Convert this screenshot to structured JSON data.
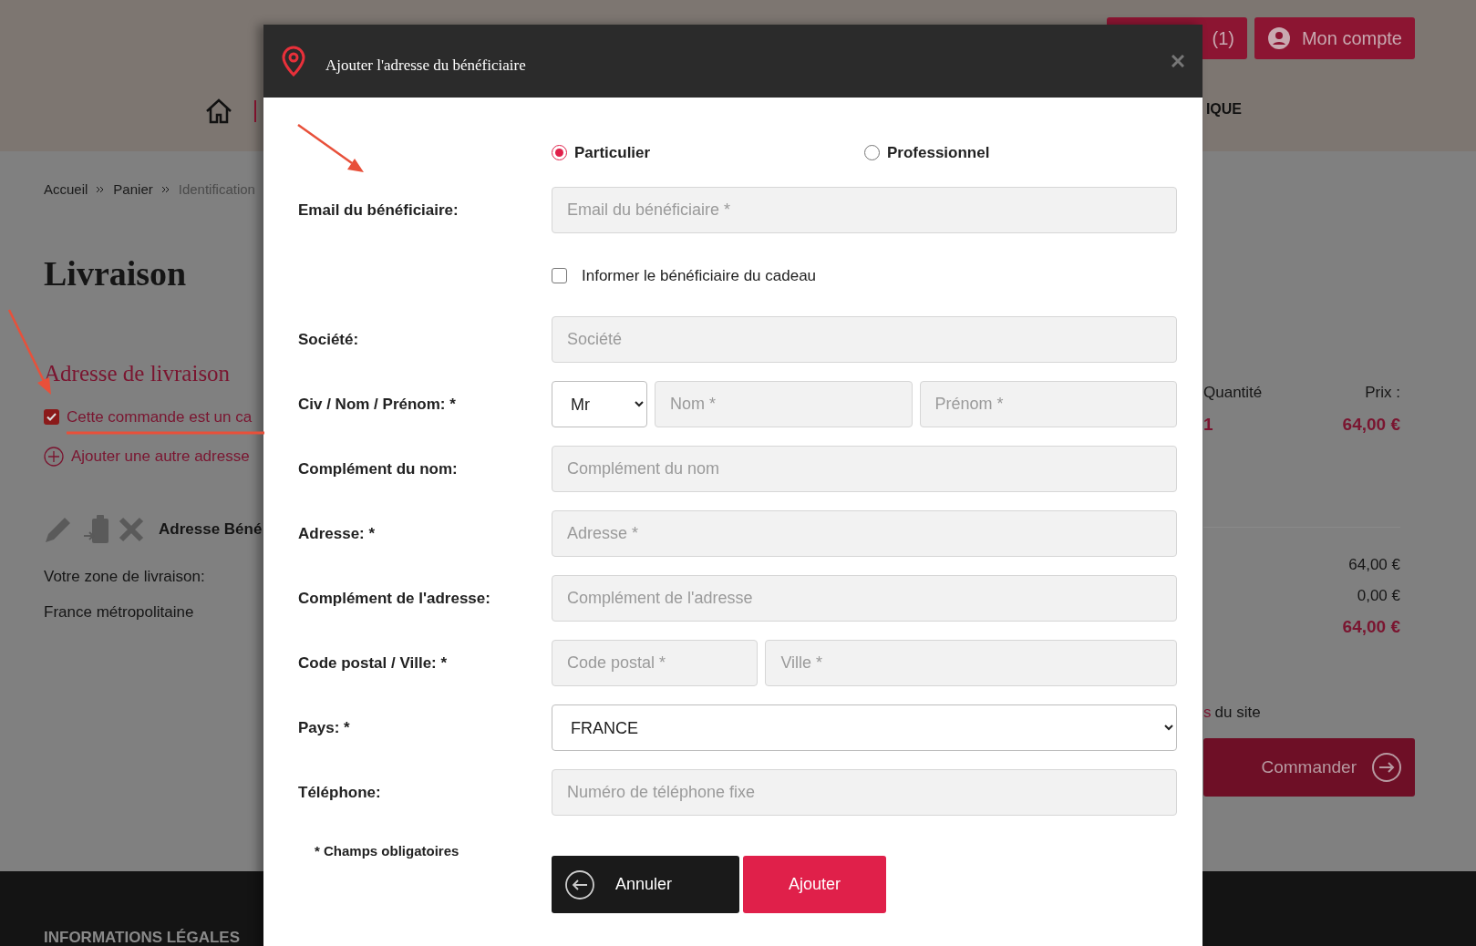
{
  "page": {
    "header": {
      "cart_button": "(1)",
      "account_button": "Mon compte",
      "nav_fragment": "IQUE"
    },
    "breadcrumb": [
      {
        "label": "Accueil",
        "current": false
      },
      {
        "label": "Panier",
        "current": false
      },
      {
        "label": "Identification",
        "current": true
      }
    ],
    "title": "Livraison",
    "section_title": "Adresse de livraison",
    "gift_checkbox": {
      "label": "Cette commande est un ca",
      "checked": true
    },
    "add_address": "Ajouter une autre adresse",
    "address_heading": "Adresse Béné",
    "zone_label": "Votre zone de livraison:",
    "zone_value": "France métropolitaine",
    "summary": {
      "quantity_header": "Quantité",
      "price_header": "Prix :",
      "quantity": "1",
      "price": "64,00 €",
      "subtotal": "64,00 €",
      "shipping": "0,00 €",
      "total": "64,00 €",
      "terms_link_fragment": "s",
      "terms_text": "du site",
      "order_button": "Commander"
    },
    "footer": {
      "heading": "INFORMATIONS LÉGALES"
    }
  },
  "modal": {
    "title": "Ajouter l'adresse du bénéficiaire",
    "customer_types": [
      {
        "label": "Particulier",
        "selected": true
      },
      {
        "label": "Professionnel",
        "selected": false
      }
    ],
    "rows": [
      {
        "label": "Email du bénéficiaire:",
        "controls": [
          {
            "kind": "input",
            "placeholder": "Email du bénéficiaire *"
          }
        ]
      },
      {
        "controls": [
          {
            "kind": "checkbox",
            "label": "Informer le bénéficiaire du cadeau",
            "checked": false
          }
        ]
      },
      {
        "label": "Société:",
        "controls": [
          {
            "kind": "input",
            "placeholder": "Société"
          }
        ]
      },
      {
        "label": "Civ / Nom / Prénom: *",
        "controls": [
          {
            "kind": "select",
            "value": "Mr"
          },
          {
            "kind": "input",
            "placeholder": "Nom *"
          },
          {
            "kind": "input",
            "placeholder": "Prénom *"
          }
        ]
      },
      {
        "label": "Complément du nom:",
        "controls": [
          {
            "kind": "input",
            "placeholder": "Complément du nom"
          }
        ]
      },
      {
        "label": "Adresse: *",
        "controls": [
          {
            "kind": "input",
            "placeholder": "Adresse *"
          }
        ]
      },
      {
        "label": "Complément de l'adresse:",
        "controls": [
          {
            "kind": "input",
            "placeholder": "Complément de l'adresse"
          }
        ]
      },
      {
        "label": "Code postal / Ville: *",
        "controls": [
          {
            "kind": "input",
            "placeholder": "Code postal *"
          },
          {
            "kind": "input",
            "placeholder": "Ville *"
          }
        ]
      },
      {
        "label": "Pays: *",
        "controls": [
          {
            "kind": "select",
            "value": "FRANCE"
          }
        ]
      },
      {
        "label": "Téléphone:",
        "controls": [
          {
            "kind": "input",
            "placeholder": "Numéro de téléphone fixe"
          }
        ]
      }
    ],
    "required_note": "* Champs obligatoires",
    "buttons": [
      {
        "label": "Annuler",
        "kind": "cancel"
      },
      {
        "label": "Ajouter",
        "kind": "submit"
      }
    ]
  }
}
